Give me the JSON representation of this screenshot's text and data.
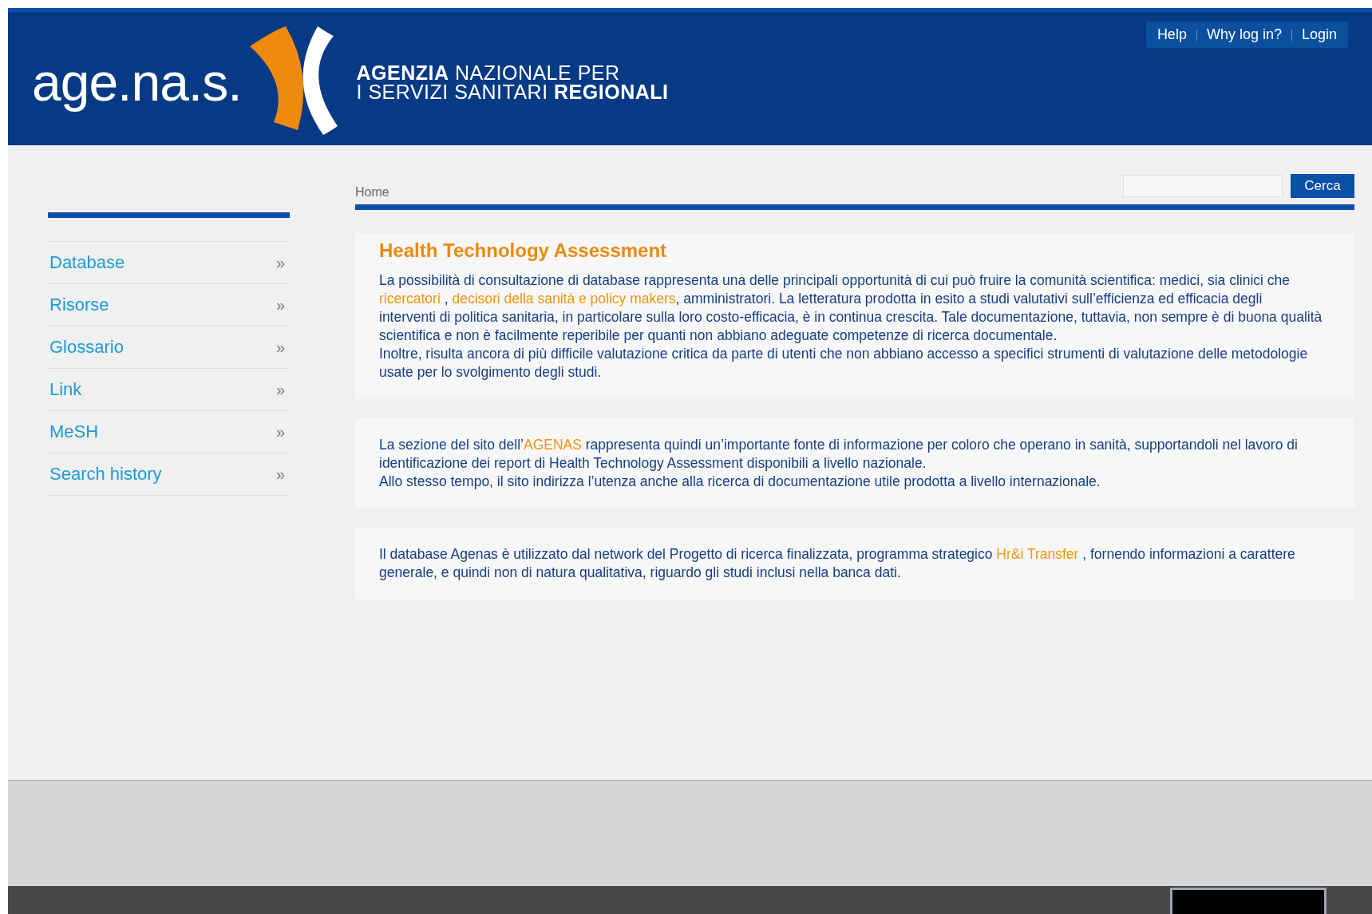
{
  "header": {
    "logo_text": "age.na.s.",
    "agency_lines": [
      "**AGENZIA** NAZIONALE PER",
      "I SERVIZI SANITARI **REGIONALI**"
    ],
    "top_links": [
      "Help",
      "Why log in?",
      "Login"
    ]
  },
  "sidebar": {
    "items": [
      {
        "label": "Database",
        "arrow": "»"
      },
      {
        "label": "Risorse",
        "arrow": "»"
      },
      {
        "label": "Glossario",
        "arrow": "»"
      },
      {
        "label": "Link",
        "arrow": "»"
      },
      {
        "label": "MeSH",
        "arrow": "»"
      },
      {
        "label": "Search history",
        "arrow": "»"
      }
    ]
  },
  "breadcrumb": "Home",
  "search": {
    "button": "Cerca"
  },
  "sections": [
    {
      "title": "Health Technology Assessment",
      "paragraphs": [
        [
          {
            "kind": "text",
            "text": "La possibilità di consultazione di database rappresenta una delle principali opportunità di cui può fruire la comunità scientifica: medici, sia clinici che "
          },
          {
            "kind": "link",
            "text": "ricercatori"
          },
          {
            "kind": "text",
            "text": " , "
          },
          {
            "kind": "link",
            "text": "decisori della sanità e policy makers"
          },
          {
            "kind": "text",
            "text": ", amministratori. La letteratura prodotta in esito a studi valutativi sull’efficienza ed efficacia degli interventi di politica sanitaria, in particolare sulla loro costo-efficacia, è in continua crescita. Tale documentazione, tuttavia, non sempre è di buona qualità scientifica e non è facilmente reperibile per quanti non abbiano adeguate competenze di ricerca documentale."
          }
        ],
        [
          {
            "kind": "text",
            "text": "Inoltre, risulta ancora di più difficile valutazione critica da parte di utenti che non abbiano accesso a specifici strumenti di valutazione delle metodologie usate per lo svolgimento degli studi."
          }
        ]
      ]
    },
    {
      "paragraphs": [
        [
          {
            "kind": "text",
            "text": "La sezione del sito dell’"
          },
          {
            "kind": "link",
            "text": "AGENAS"
          },
          {
            "kind": "text",
            "text": " rappresenta quindi un’importante fonte di informazione per coloro che operano in sanità, supportandoli nel lavoro di identificazione dei report di Health Technology Assessment disponibili a livello nazionale."
          }
        ],
        [
          {
            "kind": "text",
            "text": "Allo stesso tempo, il sito indirizza l’utenza anche alla ricerca di documentazione utile prodotta a livello internazionale."
          }
        ]
      ]
    },
    {
      "paragraphs": [
        [
          {
            "kind": "text",
            "text": "Il database Agenas è utilizzato dal network del Progetto di ricerca finalizzata, programma strategico "
          },
          {
            "kind": "link",
            "text": "Hr&i Transfer"
          },
          {
            "kind": "text",
            "text": " , fornendo informazioni a carattere generale,  e quindi non di natura qualitativa, riguardo gli studi inclusi nella banca dati."
          }
        ]
      ]
    }
  ]
}
